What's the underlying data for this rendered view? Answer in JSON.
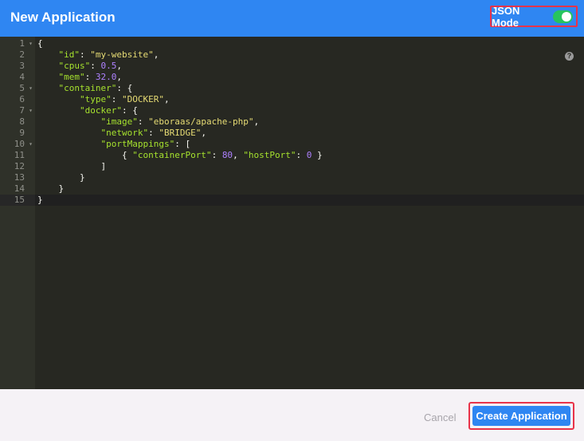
{
  "header": {
    "title": "New Application",
    "json_mode_label": "JSON Mode",
    "json_mode_on": true
  },
  "editor": {
    "lines": [
      {
        "num": "1",
        "fold": true,
        "tokens": [
          {
            "t": "p",
            "v": "{"
          }
        ]
      },
      {
        "num": "2",
        "fold": false,
        "tokens": [
          {
            "t": "p",
            "v": "    "
          },
          {
            "t": "k",
            "v": "\"id\""
          },
          {
            "t": "p",
            "v": ": "
          },
          {
            "t": "s",
            "v": "\"my-website\""
          },
          {
            "t": "p",
            "v": ","
          }
        ]
      },
      {
        "num": "3",
        "fold": false,
        "tokens": [
          {
            "t": "p",
            "v": "    "
          },
          {
            "t": "k",
            "v": "\"cpus\""
          },
          {
            "t": "p",
            "v": ": "
          },
          {
            "t": "n",
            "v": "0.5"
          },
          {
            "t": "p",
            "v": ","
          }
        ]
      },
      {
        "num": "4",
        "fold": false,
        "tokens": [
          {
            "t": "p",
            "v": "    "
          },
          {
            "t": "k",
            "v": "\"mem\""
          },
          {
            "t": "p",
            "v": ": "
          },
          {
            "t": "n",
            "v": "32.0"
          },
          {
            "t": "p",
            "v": ","
          }
        ]
      },
      {
        "num": "5",
        "fold": true,
        "tokens": [
          {
            "t": "p",
            "v": "    "
          },
          {
            "t": "k",
            "v": "\"container\""
          },
          {
            "t": "p",
            "v": ": {"
          }
        ]
      },
      {
        "num": "6",
        "fold": false,
        "tokens": [
          {
            "t": "p",
            "v": "        "
          },
          {
            "t": "k",
            "v": "\"type\""
          },
          {
            "t": "p",
            "v": ": "
          },
          {
            "t": "s",
            "v": "\"DOCKER\""
          },
          {
            "t": "p",
            "v": ","
          }
        ]
      },
      {
        "num": "7",
        "fold": true,
        "tokens": [
          {
            "t": "p",
            "v": "        "
          },
          {
            "t": "k",
            "v": "\"docker\""
          },
          {
            "t": "p",
            "v": ": {"
          }
        ]
      },
      {
        "num": "8",
        "fold": false,
        "tokens": [
          {
            "t": "p",
            "v": "            "
          },
          {
            "t": "k",
            "v": "\"image\""
          },
          {
            "t": "p",
            "v": ": "
          },
          {
            "t": "s",
            "v": "\"eboraas/apache-php\""
          },
          {
            "t": "p",
            "v": ","
          }
        ]
      },
      {
        "num": "9",
        "fold": false,
        "tokens": [
          {
            "t": "p",
            "v": "            "
          },
          {
            "t": "k",
            "v": "\"network\""
          },
          {
            "t": "p",
            "v": ": "
          },
          {
            "t": "s",
            "v": "\"BRIDGE\""
          },
          {
            "t": "p",
            "v": ","
          }
        ]
      },
      {
        "num": "10",
        "fold": true,
        "tokens": [
          {
            "t": "p",
            "v": "            "
          },
          {
            "t": "k",
            "v": "\"portMappings\""
          },
          {
            "t": "p",
            "v": ": ["
          }
        ]
      },
      {
        "num": "11",
        "fold": false,
        "tokens": [
          {
            "t": "p",
            "v": "                { "
          },
          {
            "t": "k",
            "v": "\"containerPort\""
          },
          {
            "t": "p",
            "v": ": "
          },
          {
            "t": "n",
            "v": "80"
          },
          {
            "t": "p",
            "v": ", "
          },
          {
            "t": "k",
            "v": "\"hostPort\""
          },
          {
            "t": "p",
            "v": ": "
          },
          {
            "t": "n",
            "v": "0"
          },
          {
            "t": "p",
            "v": " }"
          }
        ]
      },
      {
        "num": "12",
        "fold": false,
        "tokens": [
          {
            "t": "p",
            "v": "            ]"
          }
        ]
      },
      {
        "num": "13",
        "fold": false,
        "tokens": [
          {
            "t": "p",
            "v": "        }"
          }
        ]
      },
      {
        "num": "14",
        "fold": false,
        "tokens": [
          {
            "t": "p",
            "v": "    }"
          }
        ]
      },
      {
        "num": "15",
        "fold": false,
        "active": true,
        "tokens": [
          {
            "t": "p",
            "v": "}"
          }
        ]
      }
    ],
    "help_icon": "question-icon",
    "help_glyph": "?"
  },
  "footer": {
    "cancel_label": "Cancel",
    "create_label": "Create Application"
  },
  "colors": {
    "header_bg": "#2f86f2",
    "toggle_on": "#27c45f",
    "highlight_border": "#e8334a",
    "editor_bg": "#272822",
    "key": "#a6e22e",
    "string": "#e6db74",
    "number": "#ae81ff"
  }
}
